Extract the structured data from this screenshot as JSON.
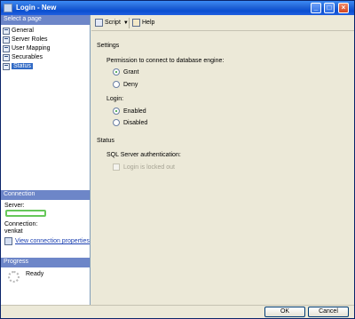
{
  "window": {
    "title": "Login - New"
  },
  "left_pane": {
    "select_page_header": "Select a page",
    "pages": [
      {
        "label": "General",
        "selected": false
      },
      {
        "label": "Server Roles",
        "selected": false
      },
      {
        "label": "User Mapping",
        "selected": false
      },
      {
        "label": "Securables",
        "selected": false
      },
      {
        "label": "Status",
        "selected": true
      }
    ],
    "connection_header": "Connection",
    "server_label": "Server:",
    "connection_label": "Connection:",
    "connection_value": "venkat",
    "view_connection_link": "View connection properties",
    "progress_header": "Progress",
    "progress_status": "Ready"
  },
  "toolbar": {
    "script_label": "Script",
    "help_label": "Help"
  },
  "settings": {
    "heading": "Settings",
    "permission_label": "Permission to connect to database engine:",
    "permission_options": [
      {
        "label": "Grant",
        "selected": true
      },
      {
        "label": "Deny",
        "selected": false
      }
    ],
    "login_label": "Login:",
    "login_options": [
      {
        "label": "Enabled",
        "selected": true
      },
      {
        "label": "Disabled",
        "selected": false
      }
    ]
  },
  "status": {
    "heading": "Status",
    "auth_label": "SQL Server authentication:",
    "locked_out_label": "Login is locked out",
    "locked_out_checked": false
  },
  "buttons": {
    "ok": "OK",
    "cancel": "Cancel"
  }
}
